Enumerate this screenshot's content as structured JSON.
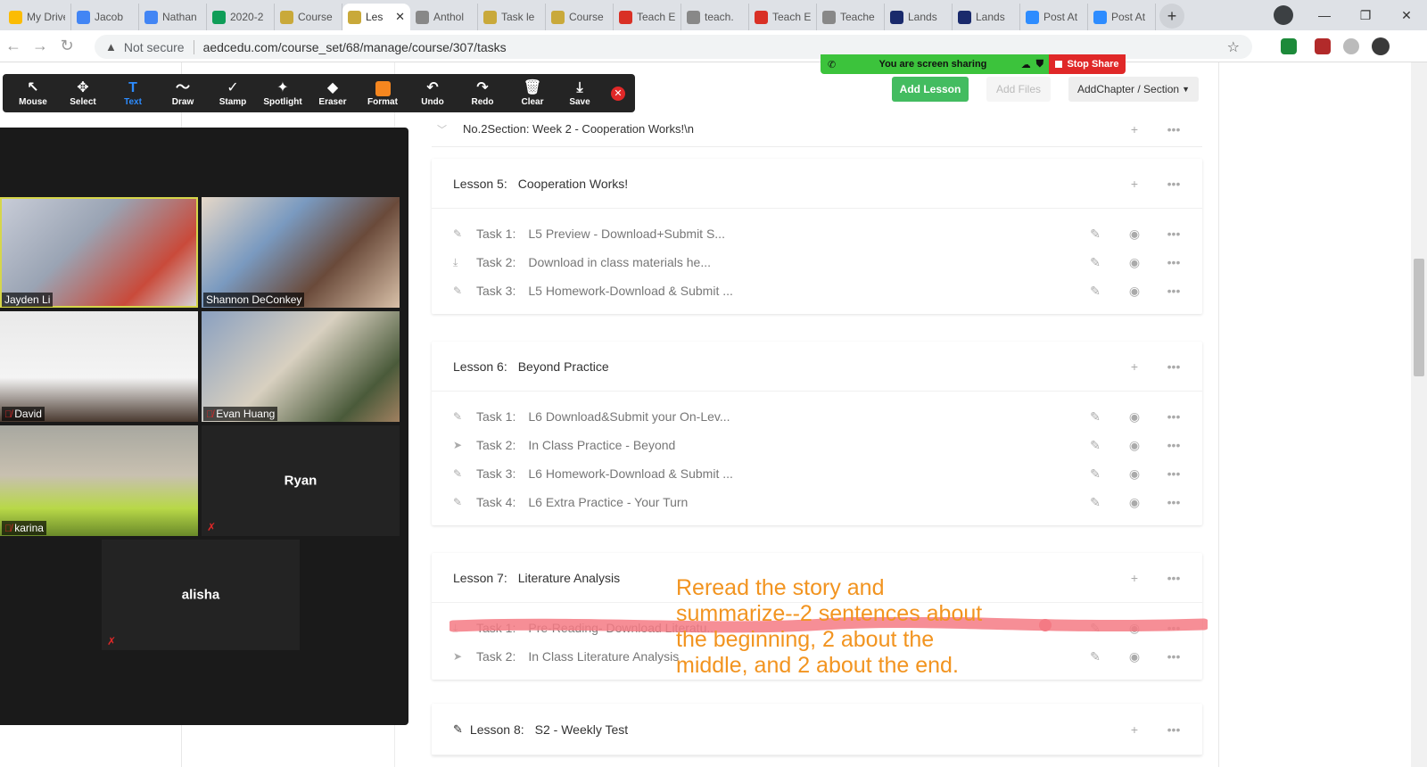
{
  "browser": {
    "tabs": [
      {
        "label": "My Drive",
        "color": "#fbbc04"
      },
      {
        "label": "Jacob",
        "color": "#4285f4"
      },
      {
        "label": "Nathan",
        "color": "#4285f4"
      },
      {
        "label": "2020-2",
        "color": "#0f9d58"
      },
      {
        "label": "Course",
        "color": "#c9a93a"
      },
      {
        "label": "Les",
        "color": "#c9a93a",
        "active": true
      },
      {
        "label": "Anthol",
        "color": "#888888"
      },
      {
        "label": "Task le",
        "color": "#c9a93a"
      },
      {
        "label": "Course",
        "color": "#c9a93a"
      },
      {
        "label": "Teach E",
        "color": "#d93025"
      },
      {
        "label": "teach.",
        "color": "#888888"
      },
      {
        "label": "Teach E",
        "color": "#d93025"
      },
      {
        "label": "Teache",
        "color": "#888888"
      },
      {
        "label": "Lands",
        "color": "#1a2a6c"
      },
      {
        "label": "Lands",
        "color": "#1a2a6c"
      },
      {
        "label": "Post At",
        "color": "#2d8cff"
      },
      {
        "label": "Post At",
        "color": "#2d8cff"
      }
    ],
    "not_secure": "Not secure",
    "url": "aedcedu.com/course_set/68/manage/course/307/tasks"
  },
  "zoom_toolbar": {
    "items": [
      {
        "name": "mouse",
        "label": "Mouse",
        "icon": "↖"
      },
      {
        "name": "select",
        "label": "Select",
        "icon": "✥"
      },
      {
        "name": "text",
        "label": "Text",
        "icon": "T",
        "active": true
      },
      {
        "name": "draw",
        "label": "Draw",
        "icon": "〜"
      },
      {
        "name": "stamp",
        "label": "Stamp",
        "icon": "✓"
      },
      {
        "name": "spotlight",
        "label": "Spotlight",
        "icon": "✦"
      },
      {
        "name": "eraser",
        "label": "Eraser",
        "icon": "◆"
      },
      {
        "name": "format",
        "label": "Format",
        "icon": ""
      },
      {
        "name": "undo",
        "label": "Undo",
        "icon": "↶"
      },
      {
        "name": "redo",
        "label": "Redo",
        "icon": "↷"
      },
      {
        "name": "clear",
        "label": "Clear",
        "icon": "🗑"
      },
      {
        "name": "save",
        "label": "Save",
        "icon": "⤓"
      }
    ],
    "format_color": "#f5861f"
  },
  "screen_share": {
    "status": "You are screen sharing",
    "stop_label": "Stop Share"
  },
  "page": {
    "add_lesson": "Add Lesson",
    "add_files": "Add Files",
    "add_chapter": "AddChapter / Section",
    "section_title": "No.2Section:  Week 2 - Cooperation Works!\\n",
    "lessons": [
      {
        "num": "Lesson 5:",
        "title": "Cooperation Works!",
        "tasks": [
          {
            "num": "Task 1:",
            "title": "L5 Preview - Download+Submit S...",
            "icon": "✎"
          },
          {
            "num": "Task 2:",
            "title": "Download in class materials he...",
            "icon": "⤓"
          },
          {
            "num": "Task 3:",
            "title": "L5 Homework-Download & Submit ...",
            "icon": "✎"
          }
        ]
      },
      {
        "num": "Lesson 6:",
        "title": "Beyond Practice",
        "tasks": [
          {
            "num": "Task 1:",
            "title": "L6 Download&Submit your On-Lev...",
            "icon": "✎"
          },
          {
            "num": "Task 2:",
            "title": "In Class Practice - Beyond",
            "icon": "➤"
          },
          {
            "num": "Task 3:",
            "title": "L6 Homework-Download & Submit ...",
            "icon": "✎"
          },
          {
            "num": "Task 4:",
            "title": "L6 Extra Practice - Your Turn",
            "icon": "✎"
          }
        ]
      },
      {
        "num": "Lesson 7:",
        "title": "Literature Analysis",
        "tasks": [
          {
            "num": "Task 1:",
            "title": "Pre-Reading- Download Literatu...",
            "icon": "⤓"
          },
          {
            "num": "Task 2:",
            "title": "In Class Literature Analysis",
            "icon": "➤"
          }
        ]
      },
      {
        "num": "Lesson 8:",
        "title": "S2 - Weekly Test",
        "tasks": []
      }
    ]
  },
  "participants": [
    {
      "name": "Jayden Li",
      "muted": false,
      "video": true,
      "speaking": true
    },
    {
      "name": "Shannon DeConkey",
      "muted": false,
      "video": true
    },
    {
      "name": "David",
      "muted": true,
      "video": true
    },
    {
      "name": "Evan Huang",
      "muted": true,
      "video": true
    },
    {
      "name": "karina",
      "muted": true,
      "video": true
    },
    {
      "name": "Ryan",
      "muted": true,
      "video": false
    },
    {
      "name": "alisha",
      "muted": true,
      "video": false
    }
  ],
  "annotation": {
    "text": "Reread the story and summarize--2 sentences about the beginning, 2 about the middle, and 2 about the end.",
    "color": "#f29420",
    "stroke_color": "#f47a84"
  }
}
